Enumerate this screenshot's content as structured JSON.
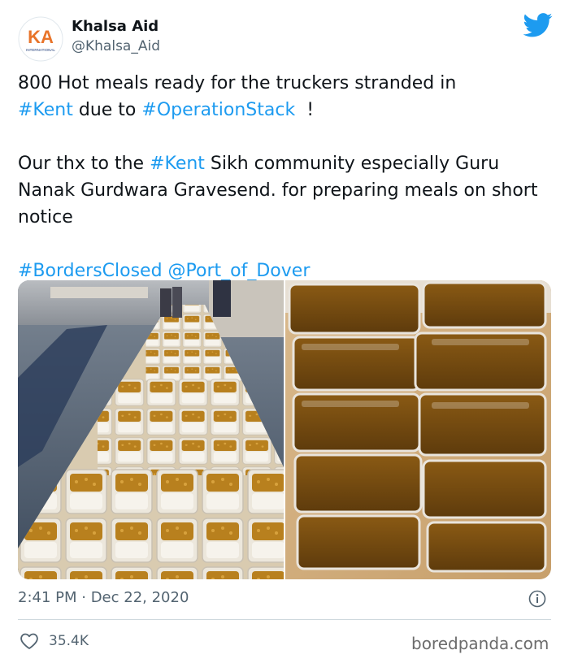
{
  "tweet": {
    "author_name": "Khalsa Aid",
    "author_handle": "@Khalsa_Aid",
    "avatar_text": "KA",
    "avatar_subtext": "INTERNATIONAL",
    "line1_pre": "800 Hot meals ready for the truckers stranded in",
    "tag_kent": "#Kent",
    "due_to": " due to ",
    "tag_operationstack": "#OperationStack",
    "line2_suffix": "  !",
    "para2_pre": "Our thx to the ",
    "para2_rest": " Sikh community especially Guru Nanak Gurdwara Gravesend. for preparing meals on short notice",
    "tag_bordersclosed": "#BordersClosed",
    "mention_port": "@Port_of_Dover",
    "timestamp": "2:41 PM · Dec 22, 2020",
    "likes": "35.4K"
  },
  "watermark": "boredpanda.com",
  "colors": {
    "link": "#1d9bf0",
    "twitter_blue": "#1d9bf0",
    "muted": "#536471",
    "avatar_orange": "#e8742a",
    "avatar_navy": "#1f3d7a"
  },
  "icons": [
    "twitter-bird-icon",
    "info-icon",
    "heart-icon"
  ]
}
